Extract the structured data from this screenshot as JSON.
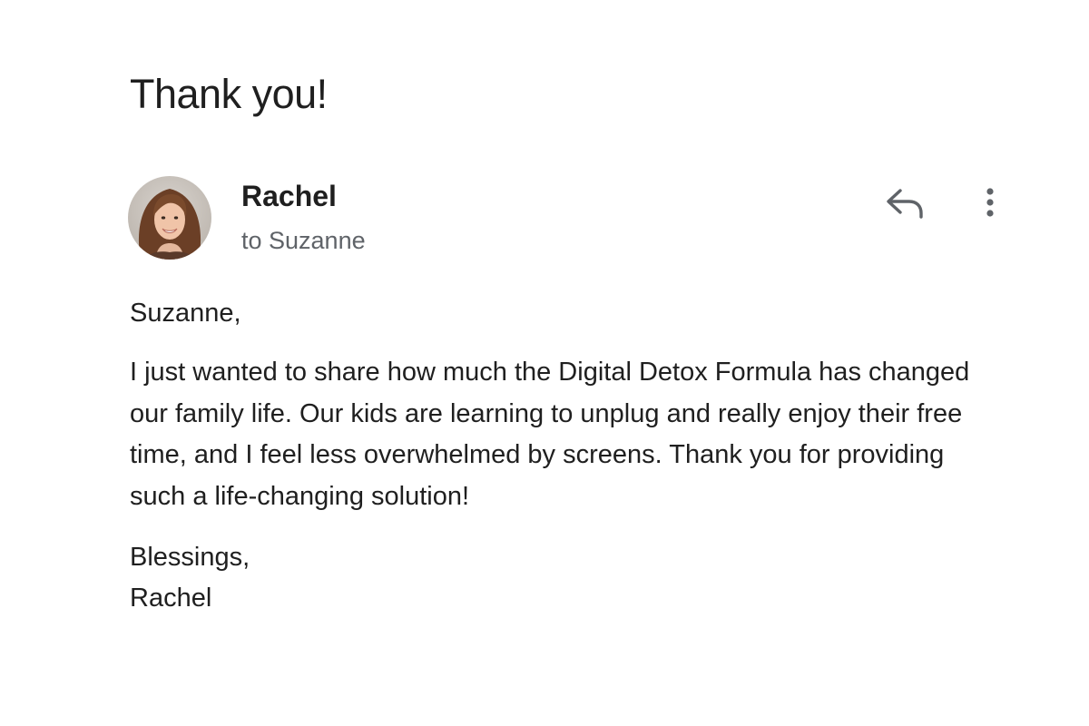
{
  "email": {
    "subject": "Thank you!",
    "sender": {
      "name": "Rachel",
      "recipient_line": "to Suzanne"
    },
    "actions": {
      "reply_icon": "reply-arrow-icon",
      "more_icon": "more-vert-icon"
    },
    "body": {
      "greeting": "Suzanne,",
      "paragraph": "I just wanted to share how much the Digital Detox Formula has changed our family life. Our kids are learning to unplug and really enjoy their free time, and I feel less overwhelmed by screens. Thank you for providing such a life-changing solution!",
      "signoff": "Blessings,",
      "signature": "Rachel"
    }
  },
  "colors": {
    "text_primary": "#1f1f1f",
    "text_secondary": "#5f6368",
    "icon": "#5f6368",
    "background": "#ffffff"
  }
}
